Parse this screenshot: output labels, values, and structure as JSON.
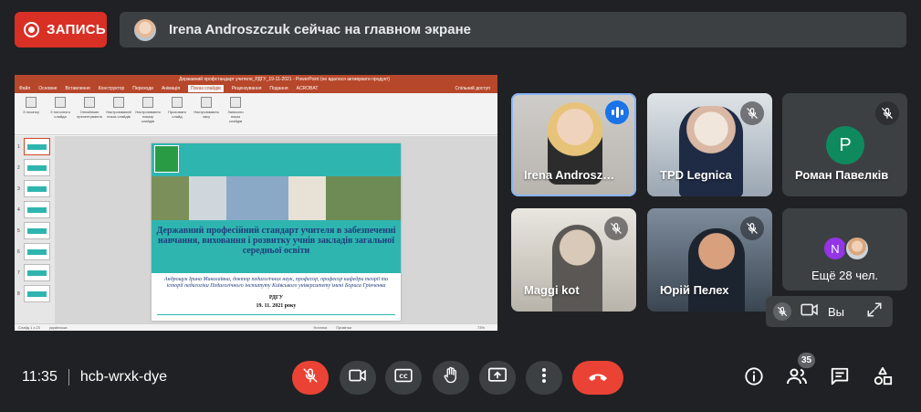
{
  "recording": {
    "label": "ЗАПИСЬ"
  },
  "presenter_bar": {
    "text": "Irena Androszczuk сейчас на главном экране"
  },
  "shared_screen": {
    "window_title": "Державний профстандарт учителя_РДГУ_19-11-2021 - PowerPoint (не вдалося активувати продукт)",
    "tabs": [
      "Файл",
      "Основне",
      "Вставлення",
      "Конструктор",
      "Переходи",
      "Анімація",
      "Показ слайдів",
      "Рецензування",
      "Подання",
      "ACROBAT"
    ],
    "active_tab": "Показ слайдів",
    "share_label": "Спільний доступ",
    "ribbon_items": [
      "З початку",
      "З поточного слайда",
      "Онлайнове презентування",
      "Настроюваний показ слайдів",
      "Настроювання показу слайдів",
      "Приховати слайд",
      "Настроювання часу",
      "Записати показ слайдів"
    ],
    "slide_numbers": [
      "1",
      "2",
      "3",
      "4",
      "5",
      "6",
      "7",
      "8"
    ],
    "slide": {
      "title": "Державний професійний стандарт учителя в забезпеченні навчання, виховання і розвитку учнів закладів загальної середньої освіти",
      "author": "Андрощук Ірина Миколаївна, доктор педагогічних наук, професор, професор кафедри теорії та історії педагогіки Педагогічного інституту Київського університету імені Бориса Грінченка",
      "org": "РДГУ",
      "date": "19. 11. 2021 року"
    },
    "status_left": "Слайд 1 з 23",
    "status_lang": "українська",
    "status_notes": "Нотатки",
    "status_comments": "Примітки",
    "zoom": "73%"
  },
  "participants": [
    {
      "name": "Irena Androsz…",
      "speaking": true
    },
    {
      "name": "TPD Legnica",
      "muted": true
    },
    {
      "name": "Роман Павелків",
      "initial": "P",
      "muted": true
    },
    {
      "name": "Maggi kot",
      "muted": true
    },
    {
      "name": "Юрій Пелех",
      "muted": true
    }
  ],
  "more_tile": {
    "initial": "N",
    "label": "Ещё 28 чел."
  },
  "self_tile": {
    "label": "Вы"
  },
  "meeting": {
    "time": "11:35",
    "code": "hcb-wrxk-dye"
  },
  "people_count": "35",
  "colors": {
    "record_red": "#d93025",
    "hangup_red": "#ea4335",
    "bar_gray": "#3c4043",
    "bg": "#202124",
    "active_blue": "#8ab4f8",
    "slide_teal": "#2fb5b0"
  },
  "icons": [
    "record-icon",
    "mic-off-icon",
    "camera-icon",
    "captions-icon",
    "raise-hand-icon",
    "present-icon",
    "more-vert-icon",
    "call-end-icon",
    "info-icon",
    "people-icon",
    "chat-icon",
    "activities-icon",
    "expand-icon",
    "speaking-icon"
  ]
}
